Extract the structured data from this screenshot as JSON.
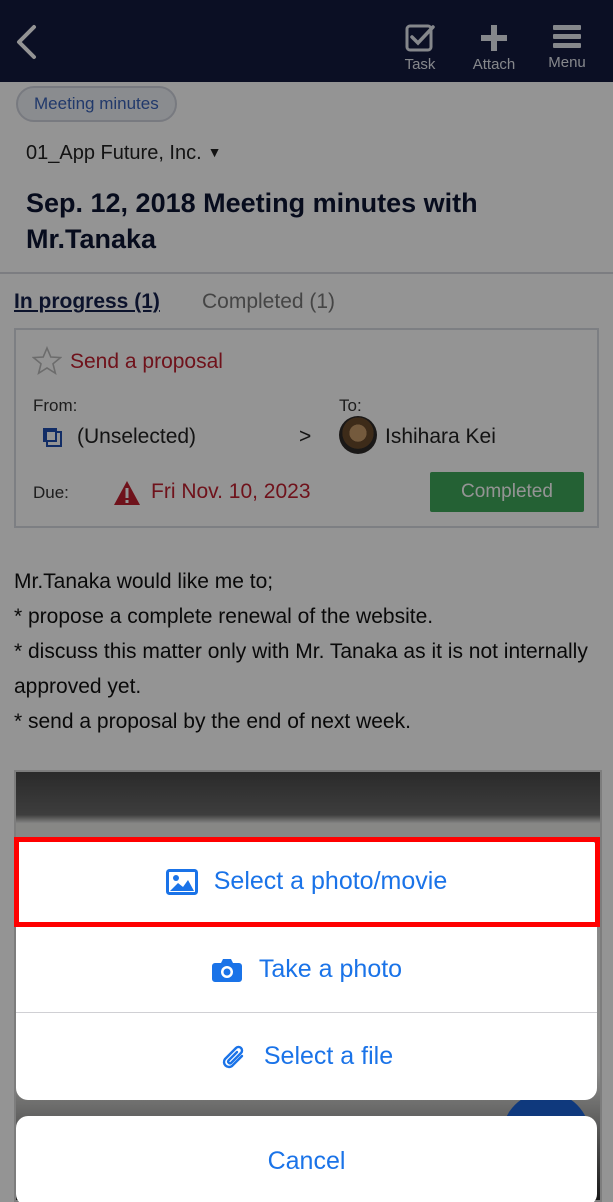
{
  "topbar": {
    "task_label": "Task",
    "attach_label": "Attach",
    "menu_label": "Menu",
    "color": "#131a3f"
  },
  "chip": "Meeting minutes",
  "company": "01_App Future, Inc.",
  "title": "Sep. 12, 2018 Meeting minutes with Mr.Tanaka",
  "tabs": {
    "in_progress": "In progress (1)",
    "completed": "Completed (1)"
  },
  "task": {
    "title": "Send a proposal",
    "from_label": "From:",
    "from_value": "(Unselected)",
    "arrow": ">",
    "to_label": "To:",
    "to_value": "Ishihara Kei",
    "due_label": "Due:",
    "due_value": "Fri Nov. 10, 2023",
    "completed_button": "Completed"
  },
  "body": {
    "line1": "Mr.Tanaka would like me to;",
    "line2": "* propose a complete renewal of the website.",
    "line3": "* discuss this matter only with Mr. Tanaka as it is not internally approved yet.",
    "line4": "* send a proposal by the end of next week."
  },
  "sheet": {
    "select_photo": "Select a photo/movie",
    "take_photo": "Take a photo",
    "select_file": "Select a file",
    "cancel": "Cancel"
  },
  "colors": {
    "accent": "#1a73e8",
    "danger": "#c0202f",
    "success": "#3ea75a",
    "highlight": "#ff0000"
  },
  "icons": [
    "back-icon",
    "task-check-icon",
    "plus-icon",
    "hamburger-icon",
    "star-icon",
    "unselected-icon",
    "warning-icon",
    "image-icon",
    "camera-icon",
    "paperclip-icon"
  ]
}
